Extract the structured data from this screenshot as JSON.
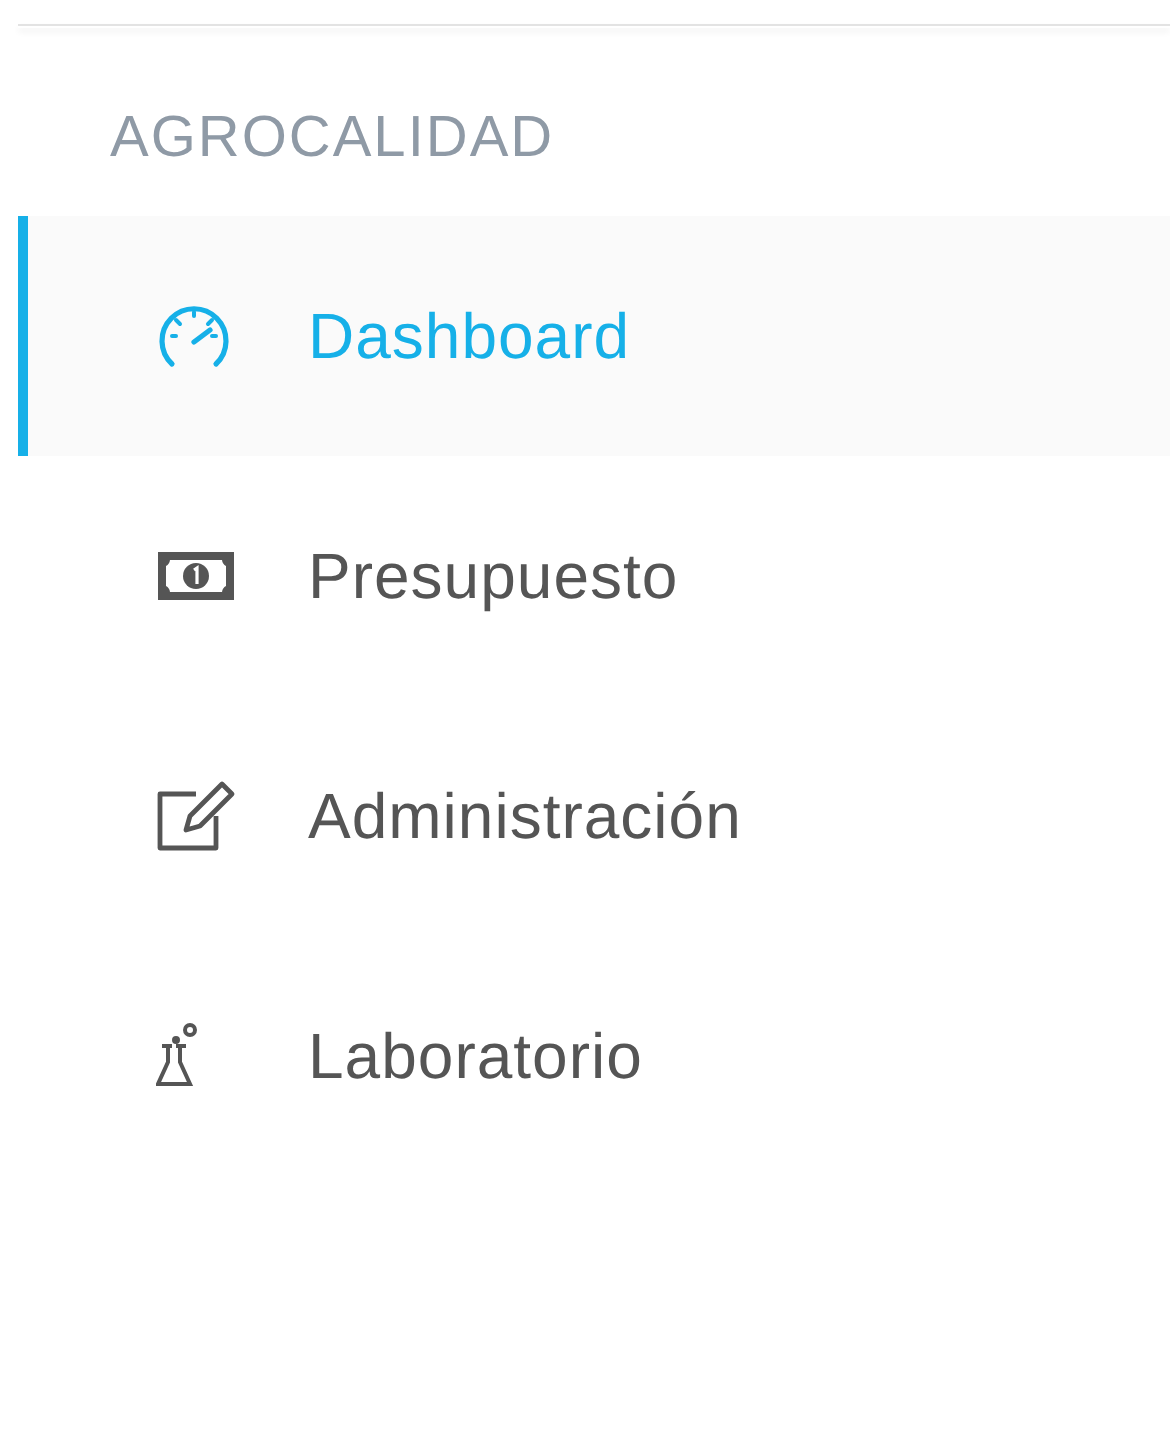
{
  "sidebar": {
    "heading": "AGROCALIDAD",
    "items": [
      {
        "label": "Dashboard",
        "selected": true
      },
      {
        "label": "Presupuesto",
        "selected": false
      },
      {
        "label": "Administración",
        "selected": false
      },
      {
        "label": "Laboratorio",
        "selected": false
      }
    ]
  }
}
